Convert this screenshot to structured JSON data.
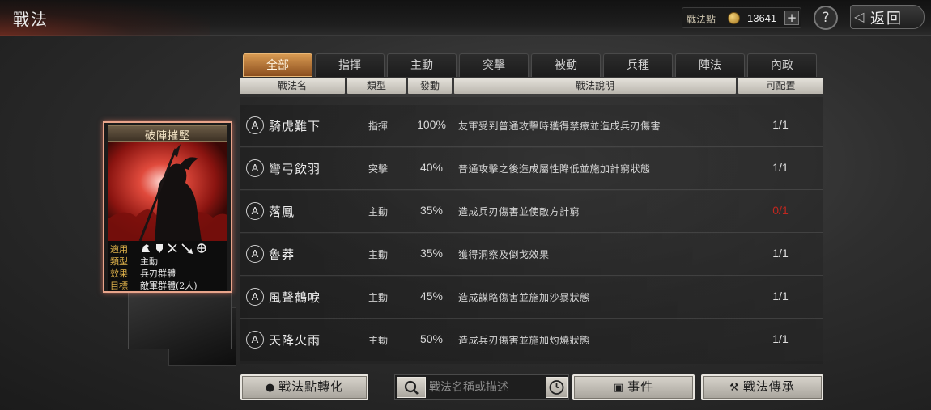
{
  "header": {
    "title": "戰法",
    "points_label": "戰法點",
    "points_value": "13641",
    "plus": "+",
    "help": "?",
    "back_label": "返回"
  },
  "tabs": [
    {
      "label": "全部",
      "active": true
    },
    {
      "label": "指揮"
    },
    {
      "label": "主動"
    },
    {
      "label": "突擊"
    },
    {
      "label": "被動"
    },
    {
      "label": "兵種"
    },
    {
      "label": "陣法"
    },
    {
      "label": "內政"
    }
  ],
  "columns": {
    "name": "戰法名",
    "type": "類型",
    "rate": "發動",
    "desc": "戰法說明",
    "avail": "可配置"
  },
  "rows": [
    {
      "grade": "A",
      "name": "騎虎難下",
      "type": "指揮",
      "rate": "100%",
      "desc": "友軍受到普通攻擊時獲得禁療並造成兵刃傷害",
      "avail": "1/1"
    },
    {
      "grade": "A",
      "name": "彎弓飲羽",
      "type": "突擊",
      "rate": "40%",
      "desc": "普通攻擊之後造成屬性降低並施加計窮狀態",
      "avail": "1/1"
    },
    {
      "grade": "A",
      "name": "落鳳",
      "type": "主動",
      "rate": "35%",
      "desc": "造成兵刃傷害並使敵方計窮",
      "avail": "0/1",
      "avail_color": "#c0271f"
    },
    {
      "grade": "A",
      "name": "魯莽",
      "type": "主動",
      "rate": "35%",
      "desc": "獲得洞察及倒戈效果",
      "avail": "1/1"
    },
    {
      "grade": "A",
      "name": "風聲鶴唳",
      "type": "主動",
      "rate": "45%",
      "desc": "造成謀略傷害並施加沙暴狀態",
      "avail": "1/1"
    },
    {
      "grade": "A",
      "name": "天降火雨",
      "type": "主動",
      "rate": "50%",
      "desc": "造成兵刃傷害並施加灼燒狀態",
      "avail": "1/1"
    }
  ],
  "card": {
    "title": "破陣摧堅",
    "applies_label": "適用",
    "applies_icons": [
      "cavalry-icon",
      "shield-icon",
      "bow-icon",
      "spear-icon",
      "wheel-icon"
    ],
    "type_label": "類型",
    "type_value": "主動",
    "effect_label": "效果",
    "effect_value": "兵刃群體",
    "target_label": "目標",
    "target_value": "敵軍群體(2人)"
  },
  "bottom": {
    "convert_label": "戰法點轉化",
    "search_placeholder": "戰法名稱或描述",
    "event_label": "事件",
    "inherit_label": "戰法傳承"
  },
  "colors": {
    "accent": "#c77f3f",
    "selected_border": "#e8a48a",
    "unavailable": "#c0271f"
  }
}
